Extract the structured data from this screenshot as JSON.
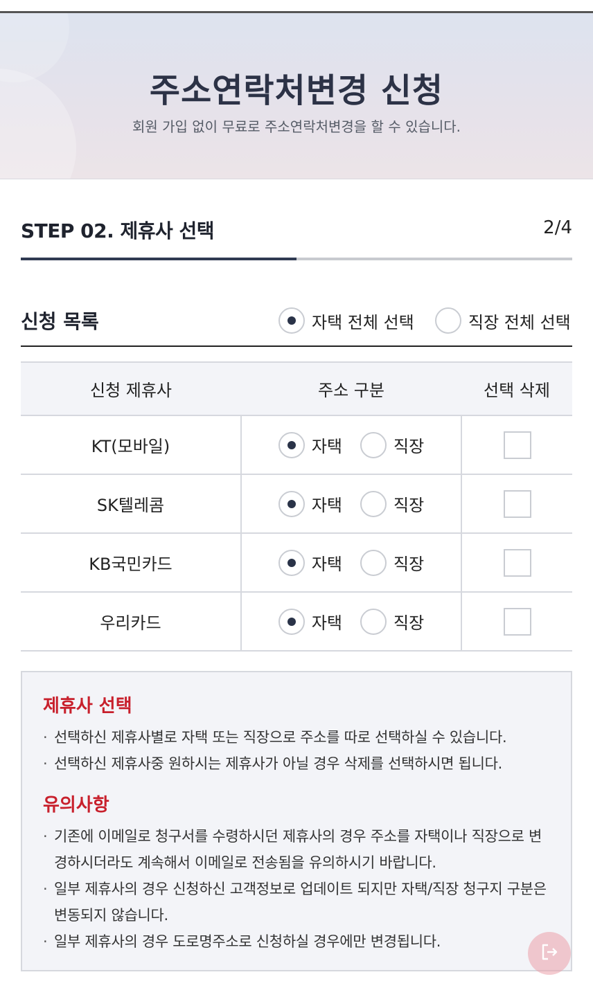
{
  "hero": {
    "title": "주소연락처변경 신청",
    "subtitle": "회원 가입 없이 무료로 주소연락처변경을 할 수 있습니다."
  },
  "step": {
    "title": "STEP 02. 제휴사 선택",
    "count": "2/4",
    "progress": 0.5
  },
  "list": {
    "title": "신청 목록",
    "select_home_all": "자택 전체 선택",
    "select_work_all": "직장 전체 선택",
    "select_home_all_checked": true,
    "select_work_all_checked": false
  },
  "table": {
    "headers": [
      "신청 제휴사",
      "주소 구분",
      "선택 삭제"
    ],
    "option_home": "자택",
    "option_work": "직장",
    "rows": [
      {
        "partner": "KT(모바일)",
        "address_type": "자택",
        "delete_checked": false
      },
      {
        "partner": "SK텔레콤",
        "address_type": "자택",
        "delete_checked": false
      },
      {
        "partner": "KB국민카드",
        "address_type": "자택",
        "delete_checked": false
      },
      {
        "partner": "우리카드",
        "address_type": "자택",
        "delete_checked": false
      }
    ]
  },
  "notice": {
    "section1_title": "제휴사 선택",
    "section1_items": [
      "선택하신 제휴사별로 자택 또는 직장으로 주소를 따로 선택하실 수 있습니다.",
      "선택하신 제휴사중 원하시는 제휴사가 아닐 경우 삭제를 선택하시면 됩니다."
    ],
    "section2_title": "유의사항",
    "section2_items": [
      "기존에 이메일로 청구서를 수령하시던 제휴사의 경우 주소를 자택이나 직장으로 변경하시더라도 계속해서 이메일로 전송됨을 유의하시기 바랍니다.",
      "일부 제휴사의 경우 신청하신 고객정보로 업데이트 되지만 자택/직장 청구지 구분은 변동되지 않습니다.",
      "일부 제휴사의 경우 도로명주소로 신청하실 경우에만 변경됩니다."
    ]
  },
  "colors": {
    "accent_navy": "#2f3a52",
    "notice_red": "#c8202c",
    "fab_pink": "#eba0aa"
  },
  "icons": {
    "fab": "exit-icon"
  }
}
